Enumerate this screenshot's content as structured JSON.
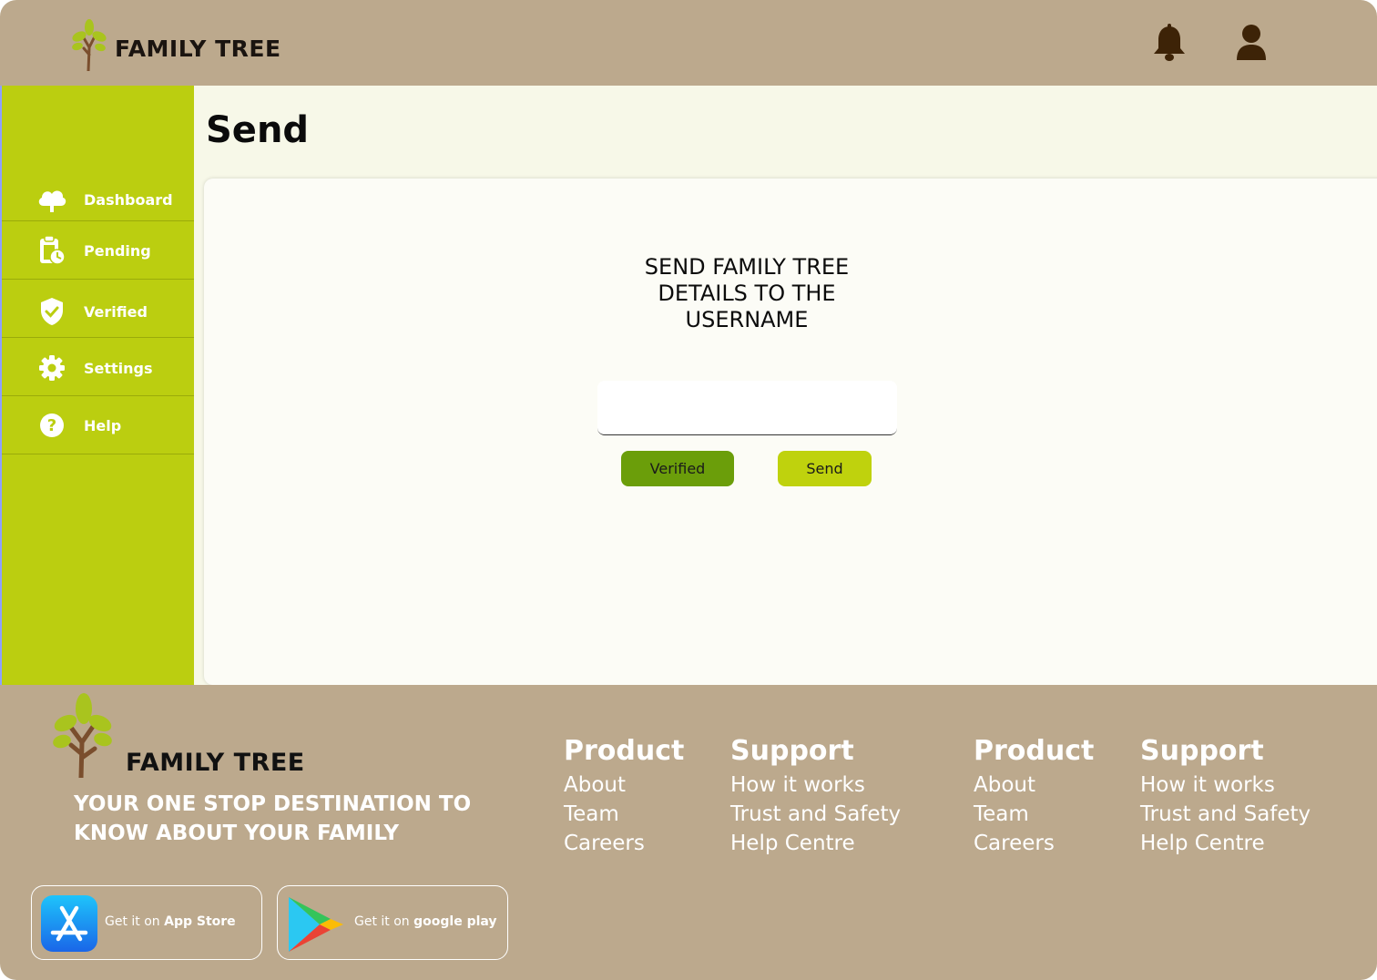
{
  "header": {
    "brand": "FAMILY TREE",
    "icons": [
      "tree-logo-icon",
      "bell-icon",
      "user-icon"
    ]
  },
  "sidebar": {
    "items": [
      {
        "label": "Dashboard",
        "icon": "cloud-tree-icon"
      },
      {
        "label": "Pending",
        "icon": "clipboard-clock-icon"
      },
      {
        "label": "Verified",
        "icon": "shield-check-icon"
      },
      {
        "label": "Settings",
        "icon": "gear-icon"
      },
      {
        "label": "Help",
        "icon": "question-icon"
      }
    ]
  },
  "main": {
    "title": "Send",
    "heading_lines": [
      "SEND FAMILY TREE",
      "DETAILS TO THE",
      "USERNAME"
    ],
    "username_value": "",
    "verified_button": "Verified",
    "send_button": "Send"
  },
  "footer": {
    "brand": "FAMILY TREE",
    "tagline_lines": [
      "YOUR ONE STOP DESTINATION TO",
      "KNOW ABOUT YOUR FAMILY"
    ],
    "columns": [
      {
        "heading": "Product",
        "links": [
          "About",
          "Team",
          "Careers"
        ]
      },
      {
        "heading": "Support",
        "links": [
          "How it works",
          "Trust and Safety",
          "Help Centre"
        ]
      },
      {
        "heading": "Product",
        "links": [
          "About",
          "Team",
          "Careers"
        ]
      },
      {
        "heading": "Support",
        "links": [
          "How it works",
          "Trust and Safety",
          "Help Centre"
        ]
      }
    ],
    "app_store": {
      "prefix": "Get it on ",
      "name": "App Store"
    },
    "google_play": {
      "prefix": "Get it on ",
      "name": "google play"
    }
  },
  "colors": {
    "header_bg": "#bca98d",
    "sidebar_bg": "#bbce10",
    "content_bg": "#f7f8e8",
    "verified_btn": "#6b9e0a",
    "send_btn": "#bfd20d"
  }
}
